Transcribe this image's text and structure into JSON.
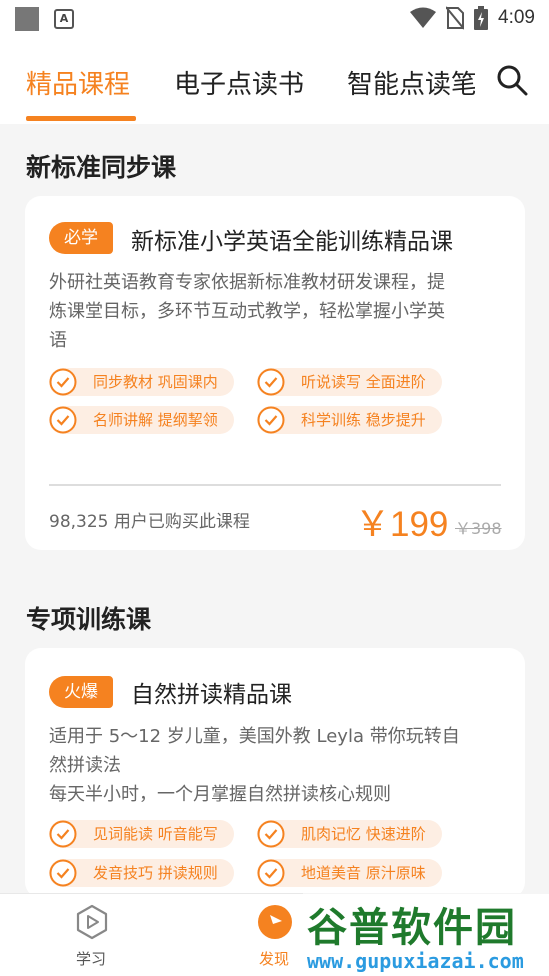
{
  "status_bar": {
    "time": "4:09"
  },
  "tabs": [
    {
      "label": "精品课程",
      "active": true
    },
    {
      "label": "电子点读书",
      "active": false
    },
    {
      "label": "智能点读笔",
      "active": false
    }
  ],
  "sections": [
    {
      "title": "新标准同步课",
      "card": {
        "badge": "必学",
        "title": "新标准小学英语全能训练精品课",
        "description_lines": [
          "外研社英语教育专家依据新标准教材研发课程，提",
          "炼课堂目标，多环节互动式教学，轻松掌握小学英",
          "语"
        ],
        "features": [
          "同步教材 巩固课内",
          "听说读写 全面进阶",
          "名师讲解 提纲挈领",
          "科学训练 稳步提升"
        ],
        "buyers": "98,325 用户已购买此课程",
        "price": "￥199",
        "original_price": "￥398"
      }
    },
    {
      "title": "专项训练课",
      "card": {
        "badge": "火爆",
        "title": "自然拼读精品课",
        "description_lines": [
          "适用于 5～12 岁儿童，美国外教 Leyla 带你玩转自",
          "然拼读法",
          "每天半小时，一个月掌握自然拼读核心规则"
        ],
        "features": [
          "见词能读 听音能写",
          "肌肉记忆 快速进阶",
          "发音技巧 拼读规则",
          "地道美音 原汁原味"
        ]
      }
    }
  ],
  "bottom_nav": [
    {
      "label": "学习",
      "icon": "play-hexagon-icon",
      "active": false
    },
    {
      "label": "发现",
      "icon": "discover-icon",
      "active": true
    }
  ],
  "watermark": {
    "text": "谷普软件园",
    "url": "www.gupuxiazai.com"
  },
  "colors": {
    "accent": "#f58220",
    "feature_bg": "#fdeee3",
    "watermark_green": "#1f7a2c",
    "watermark_blue": "#2b9be0"
  }
}
